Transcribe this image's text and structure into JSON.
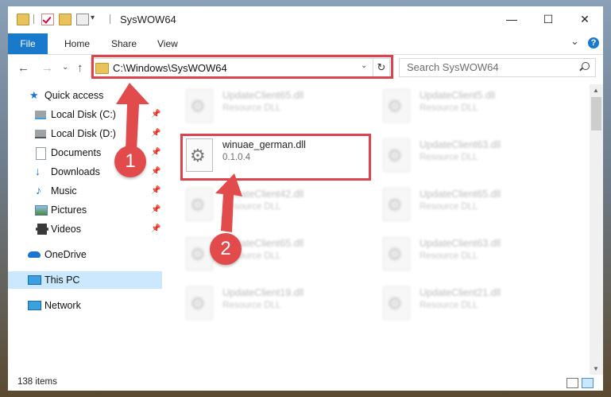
{
  "window": {
    "title": "SysWOW64",
    "controls": {
      "minimize": "—",
      "maximize": "☐",
      "close": "✕"
    }
  },
  "ribbon": {
    "tabs": [
      "File",
      "Home",
      "Share",
      "View"
    ],
    "collapse": "⌄",
    "help": "?"
  },
  "nav": {
    "back": "←",
    "forward": "→",
    "recent": "⌄",
    "up": "↑",
    "address": "C:\\Windows\\SysWOW64",
    "dropdown": "⌄",
    "refresh": "↻",
    "search_placeholder": "Search SysWOW64"
  },
  "sidebar": {
    "items": [
      {
        "label": "Quick access",
        "icon": "star-icon",
        "pinned": false
      },
      {
        "label": "Local Disk (C:)",
        "icon": "drive-icon",
        "pinned": true
      },
      {
        "label": "Local Disk (D:)",
        "icon": "drive-icon",
        "pinned": true
      },
      {
        "label": "Documents",
        "icon": "documents-icon",
        "pinned": true
      },
      {
        "label": "Downloads",
        "icon": "downloads-icon",
        "pinned": true
      },
      {
        "label": "Music",
        "icon": "music-icon",
        "pinned": true
      },
      {
        "label": "Pictures",
        "icon": "pictures-icon",
        "pinned": true
      },
      {
        "label": "Videos",
        "icon": "videos-icon",
        "pinned": true
      },
      {
        "label": "OneDrive",
        "icon": "cloud-icon"
      },
      {
        "label": "This PC",
        "icon": "computer-icon",
        "selected": true
      },
      {
        "label": "Network",
        "icon": "network-icon"
      }
    ],
    "pin_glyph": "📌"
  },
  "files": [
    {
      "name": "UpdateClient65.dll",
      "type": "Resource DLL"
    },
    {
      "name": "UpdateClient5.dll",
      "type": "Resource DLL"
    },
    {
      "name": "winuae_german.dll",
      "type": "0.1.0.4"
    },
    {
      "name": "UpdateClient63.dll",
      "type": "Resource DLL"
    },
    {
      "name": "UpdateClient42.dll",
      "type": "Resource DLL"
    },
    {
      "name": "UpdateClient65.dll",
      "type": "Resource DLL"
    },
    {
      "name": "UpdateClient65.dll",
      "type": "Resource DLL"
    },
    {
      "name": "UpdateClient63.dll",
      "type": "Resource DLL"
    },
    {
      "name": "UpdateClient19.dll",
      "type": "Resource DLL"
    },
    {
      "name": "UpdateClient21.dll",
      "type": "Resource DLL"
    }
  ],
  "status": {
    "count": "138 items"
  },
  "annotations": {
    "step1": "1",
    "step2": "2",
    "accent": "#d9444f"
  }
}
